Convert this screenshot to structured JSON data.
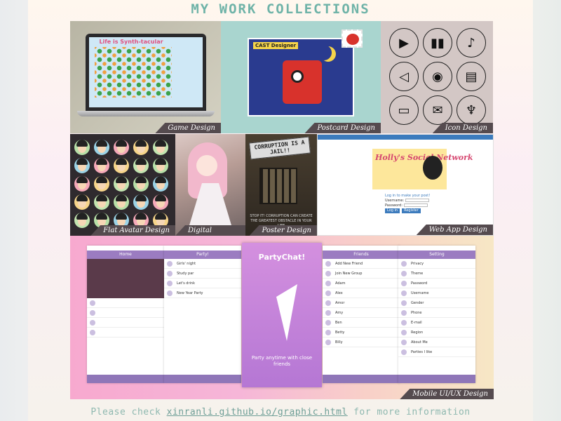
{
  "header": {
    "title": "MY WORK COLLECTIONS"
  },
  "tiles": {
    "game": "Game Design",
    "postcard": "Postcard Design",
    "icon": "Icon Design",
    "avatar": "Flat Avatar Design",
    "painting": "Digital Painting",
    "poster": "Poster Design",
    "webapp": "Web App Design",
    "mobile": "Mobile UI/UX Design"
  },
  "game_preview": {
    "title": "Life is Synth-tacular"
  },
  "postcard_preview": {
    "title": "CAST Designer"
  },
  "poster_preview": {
    "headline": "CORRUPTION IS A JAIL!!",
    "subtitle": "STOP IT! CORRUPTION CAN CREATE THE GREATEST OBSTACLE IN YOUR LIFE"
  },
  "webapp_preview": {
    "banner": "Holly's Social Network",
    "prompt": "Log in to make your post!",
    "username": "Username:",
    "password": "Password:",
    "login": "Log in",
    "register": "Register"
  },
  "mobile_preview": {
    "app_name": "PartyChat!",
    "tagline": "Party anytime with close friends",
    "screens": [
      "Home",
      "Party!",
      "Friends",
      "Setting"
    ],
    "party_rows": [
      "Girls' night",
      "Study par",
      "Let's drink",
      "New Year Party"
    ],
    "friend_rows": [
      "Add New Friend",
      "Join New Group",
      "Adam",
      "Alex",
      "Amor",
      "Amy",
      "Ben",
      "Betty",
      "Billy"
    ],
    "setting_rows": [
      "Privacy",
      "Theme",
      "Password",
      "Username",
      "Gender",
      "Phone",
      "E-mail",
      "Region",
      "About Me",
      "Parties I like"
    ]
  },
  "footer": {
    "prefix": "Please check",
    "link": "xinranli.github.io/graphic.html",
    "suffix": "for more information"
  },
  "colors": {
    "title": "#6fb3a8",
    "caption_bg": "#554b4f",
    "footer": "#8fb9b0"
  },
  "icons": [
    "play-icon",
    "equalizer-icon",
    "music-note-icon",
    "speaker-mute-icon",
    "vinyl-record-icon",
    "document-icon",
    "camera-icon",
    "mail-icon",
    "microphone-icon"
  ]
}
